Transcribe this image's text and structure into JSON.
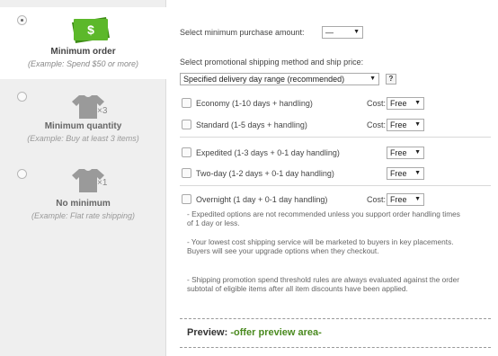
{
  "sidebar": {
    "options": [
      {
        "title": "Minimum order",
        "example": "(Example: Spend $50 or more)",
        "icon": "money-icon",
        "icon_text": "$",
        "selected": true
      },
      {
        "title": "Minimum quantity",
        "example": "(Example: Buy at least 3 items)",
        "icon": "shirt-icon",
        "multiplier": "×3",
        "selected": false
      },
      {
        "title": "No minimum",
        "example": "(Example: Flat rate shipping)",
        "icon": "shirt-icon",
        "multiplier": "×1",
        "selected": false
      }
    ]
  },
  "main": {
    "min_purchase_label": "Select minimum purchase amount:",
    "min_purchase_value": "—",
    "method_label": "Select promotional shipping method and ship price:",
    "method_value": "Specified delivery day range (recommended)",
    "help": "?",
    "cost_label": "Cost:",
    "methods": [
      {
        "name": "Economy (1-10 days + handling)",
        "cost": "Free"
      },
      {
        "name": "Standard (1-5 days + handling)",
        "cost": "Free"
      },
      {
        "name": "Expedited (1-3 days + 0-1 day handling)",
        "cost": "Free"
      },
      {
        "name": "Two-day (1-2 days + 0-1 day handling)",
        "cost": "Free"
      },
      {
        "name": "Overnight (1 day + 0-1 day handling)",
        "cost": "Free"
      }
    ],
    "notes": [
      "- Expedited options are not recommended unless you support order handling times of 1 day or less.",
      "- Your lowest cost shipping service will be marketed to buyers in key placements. Buyers will see your upgrade options when they checkout.",
      "- Shipping promotion spend threshold rules are always evaluated against the order subtotal of eligible items after all item discounts have been applied."
    ],
    "preview_label": "Preview:",
    "preview_value": "-offer preview area-"
  },
  "colors": {
    "accent_green": "#4ea51f",
    "preview_green": "#4a8a1f",
    "sidebar_bg": "#efefef"
  }
}
